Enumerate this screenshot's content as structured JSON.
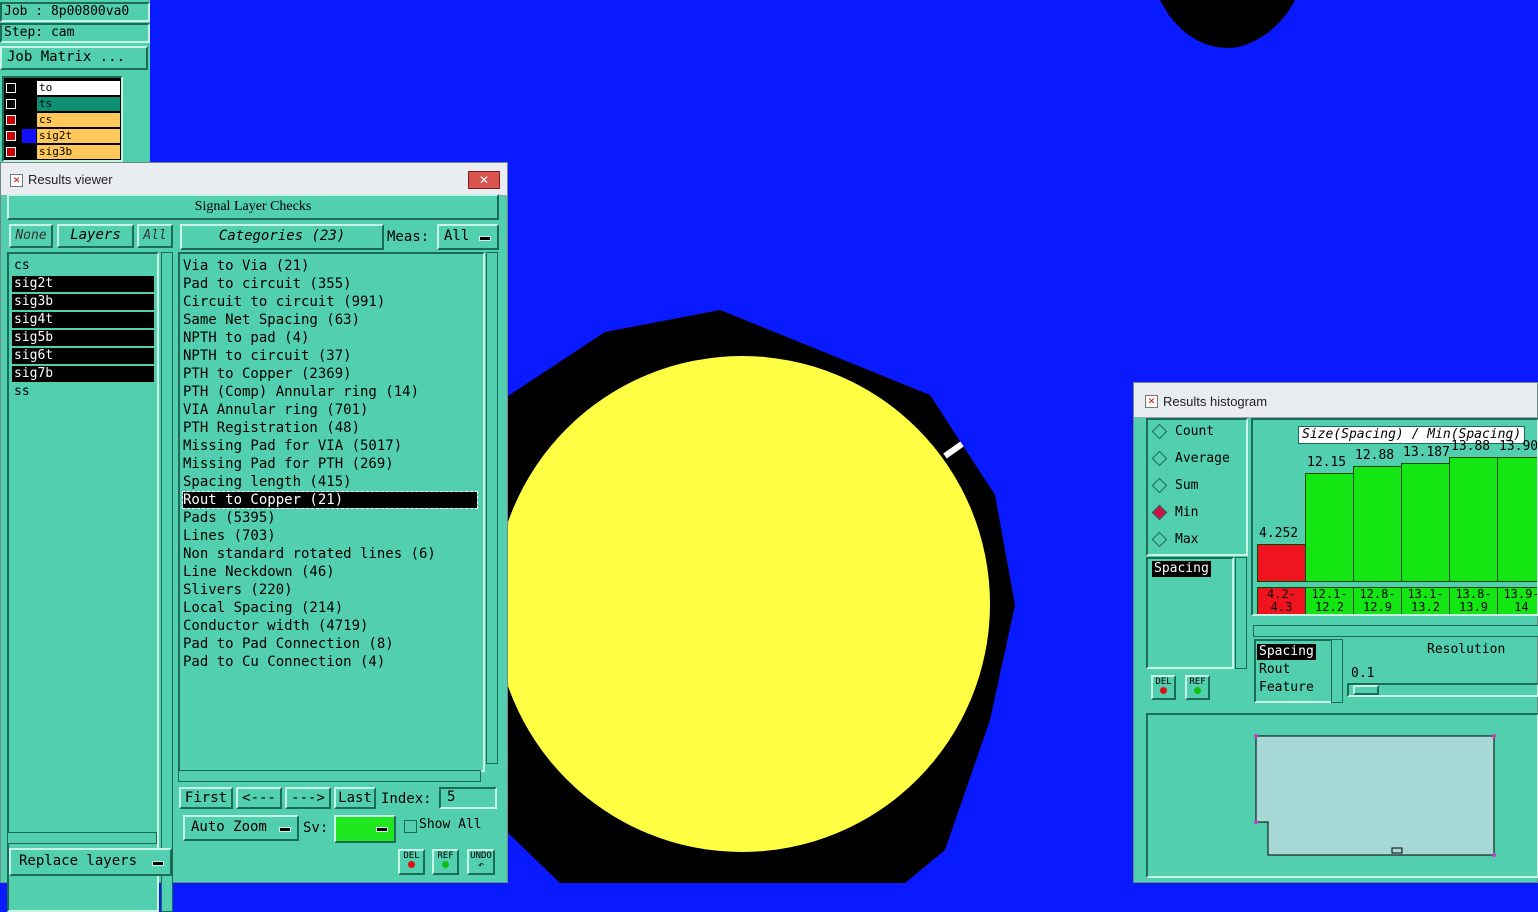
{
  "job": {
    "job_label": "Job : 8p00800va0",
    "step_label": "Step: cam",
    "matrix_button": "Job Matrix ..."
  },
  "layers_panel": [
    {
      "name": "to",
      "color": "#ffffff"
    },
    {
      "name": "ts",
      "color": "#0e8f74"
    },
    {
      "name": "cs",
      "color": "#ffc85a"
    },
    {
      "name": "sig2t",
      "color": "#ffc85a"
    },
    {
      "name": "sig3b",
      "color": "#ffc85a"
    }
  ],
  "results_viewer": {
    "title": "Results viewer",
    "header": "Signal Layer Checks",
    "none_btn": "None",
    "layers_btn": "Layers",
    "all_btn": "All",
    "categories_btn": "Categories (23)",
    "meas_label": "Meas:",
    "meas_value": "All",
    "layers": [
      {
        "label": "cs",
        "selected": false
      },
      {
        "label": "sig2t",
        "selected": true
      },
      {
        "label": "sig3b",
        "selected": true
      },
      {
        "label": "sig4t",
        "selected": true
      },
      {
        "label": "sig5b",
        "selected": true
      },
      {
        "label": "sig6t",
        "selected": true
      },
      {
        "label": "sig7b",
        "selected": true
      },
      {
        "label": "ss",
        "selected": false
      }
    ],
    "categories": [
      {
        "label": "Via to Via (21)",
        "selected": false
      },
      {
        "label": "Pad to circuit (355)",
        "selected": false
      },
      {
        "label": "Circuit to circuit (991)",
        "selected": false
      },
      {
        "label": "Same Net Spacing (63)",
        "selected": false
      },
      {
        "label": "NPTH to pad (4)",
        "selected": false
      },
      {
        "label": "NPTH to circuit (37)",
        "selected": false
      },
      {
        "label": "PTH to Copper (2369)",
        "selected": false
      },
      {
        "label": "PTH (Comp) Annular ring (14)",
        "selected": false
      },
      {
        "label": "VIA Annular ring (701)",
        "selected": false
      },
      {
        "label": "PTH Registration (48)",
        "selected": false
      },
      {
        "label": "Missing Pad for VIA (5017)",
        "selected": false
      },
      {
        "label": "Missing Pad for PTH (269)",
        "selected": false
      },
      {
        "label": "Spacing length (415)",
        "selected": false
      },
      {
        "label": "Rout to Copper (21)",
        "selected": true
      },
      {
        "label": "Pads (5395)",
        "selected": false
      },
      {
        "label": "Lines (703)",
        "selected": false
      },
      {
        "label": "Non standard rotated lines (6)",
        "selected": false
      },
      {
        "label": "Line Neckdown (46)",
        "selected": false
      },
      {
        "label": "Slivers (220)",
        "selected": false
      },
      {
        "label": "Local Spacing (214)",
        "selected": false
      },
      {
        "label": "Conductor width (4719)",
        "selected": false
      },
      {
        "label": "Pad to Pad Connection (8)",
        "selected": false
      },
      {
        "label": "Pad to Cu Connection (4)",
        "selected": false
      }
    ],
    "nav": {
      "first": "First",
      "prev": "<---",
      "next": "--->",
      "last": "Last",
      "index_label": "Index:",
      "index_value": "5"
    },
    "auto_zoom": "Auto Zoom",
    "sv_label": "Sv:",
    "sv_color": "#20e820",
    "show_all": "Show All",
    "replace_layers": "Replace layers",
    "del": "DEL",
    "ref": "REF",
    "undo": "UNDO"
  },
  "histogram": {
    "title": "Results histogram",
    "modes": [
      {
        "label": "Count",
        "selected": false
      },
      {
        "label": "Average",
        "selected": false
      },
      {
        "label": "Sum",
        "selected": false
      },
      {
        "label": "Min",
        "selected": true
      },
      {
        "label": "Max",
        "selected": false
      }
    ],
    "list_selected": "Spacing",
    "chart_title": "Size(Spacing) / Min(Spacing)",
    "attribute_list": [
      "Spacing",
      "Rout",
      "Feature"
    ],
    "resolution_label": "Resolution",
    "resolution_value": "0.1",
    "del": "DEL",
    "ref": "REF"
  },
  "chart_data": {
    "type": "bar",
    "title": "Size(Spacing) / Min(Spacing)",
    "bin_labels_top": [
      "4.2-",
      "12.1-",
      "12.8-",
      "13.1-",
      "13.8-",
      "13.9-"
    ],
    "bin_labels_bottom": [
      "4.3",
      "12.2",
      "12.9",
      "13.2",
      "13.9",
      "14"
    ],
    "value_labels": [
      "4.252",
      "12.15",
      "12.88",
      "13.187",
      "13.88",
      "13.90"
    ],
    "values": [
      4.252,
      12.15,
      12.88,
      13.187,
      13.88,
      13.9
    ],
    "colors": [
      "#f0141e",
      "#14e614",
      "#14e614",
      "#14e614",
      "#14e614",
      "#14e614"
    ],
    "ylim": [
      0,
      13.9
    ]
  }
}
